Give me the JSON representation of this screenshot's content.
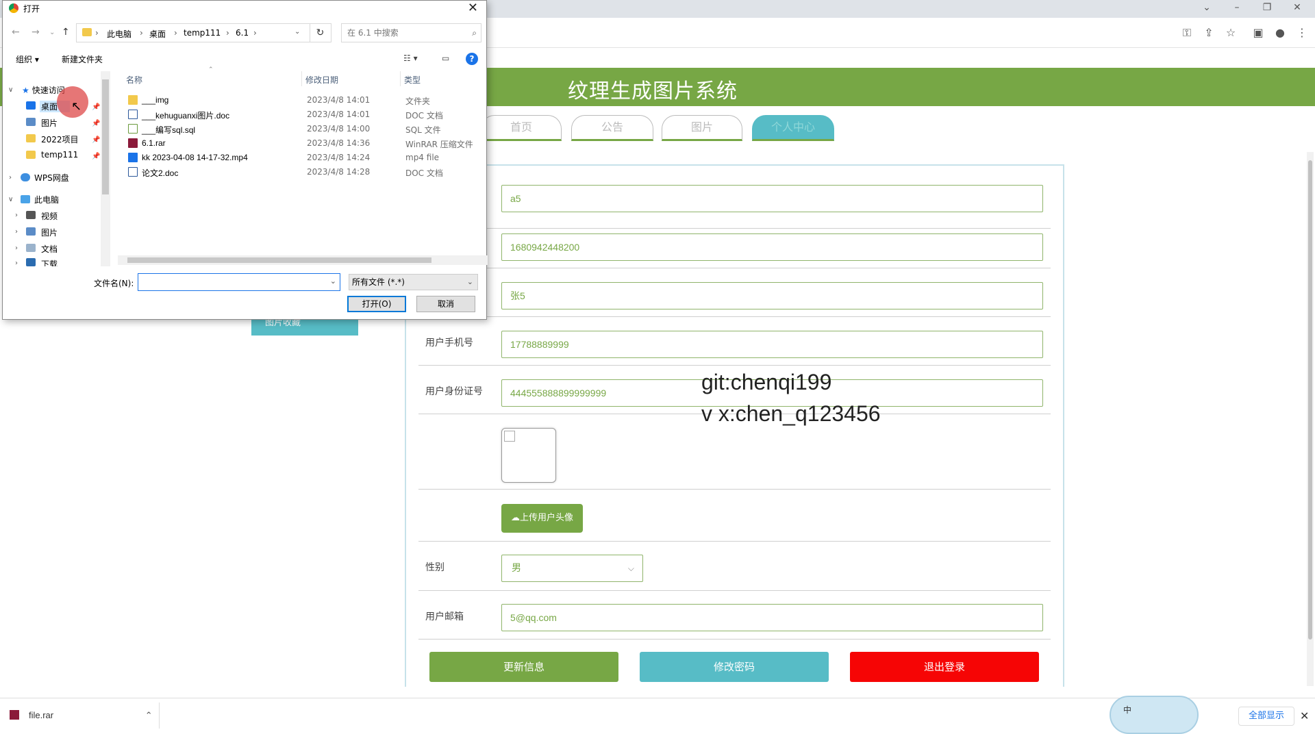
{
  "browser": {
    "window_controls": [
      "⌄",
      "–",
      "❐",
      "✕"
    ]
  },
  "page": {
    "site_title": "纹理生成图片系统",
    "nav_tabs": [
      {
        "label": "首页"
      },
      {
        "label": "公告"
      },
      {
        "label": "图片"
      },
      {
        "label": "个人中心"
      }
    ],
    "left_badge": "图片收藏",
    "form": {
      "field1_value": "a5",
      "field2_value": "1680942448200",
      "field3_value": "张5",
      "phone_label": "用户手机号",
      "phone_value": "17788889999",
      "id_label": "用户身份证号",
      "id_value": "444555888899999999",
      "upload_label": "上传用户头像",
      "gender_label": "性别",
      "gender_value": "男",
      "email_label": "用户邮箱",
      "email_value": "5@qq.com"
    },
    "buttons": {
      "update": "更新信息",
      "change_password": "修改密码",
      "logout": "退出登录"
    },
    "watermark": {
      "line1": "git:chenqi199",
      "line2": "v x:chen_q123456"
    },
    "colors": {
      "brand_green": "#77a745",
      "teal": "#57bcc6",
      "danger_red": "#f60505"
    }
  },
  "download_bar": {
    "file_name": "file.rar",
    "show_all": "全部显示",
    "ime_label": "中"
  },
  "dialog": {
    "title": "打开",
    "breadcrumb": [
      "此电脑",
      "桌面",
      "temp111",
      "6.1"
    ],
    "search_placeholder": "在 6.1 中搜索",
    "organize": "组织 ▾",
    "new_folder": "新建文件夹",
    "help": "?",
    "tree": [
      {
        "label": "快速访问"
      },
      {
        "label": "桌面"
      },
      {
        "label": "图片"
      },
      {
        "label": "2022项目"
      },
      {
        "label": "temp111"
      },
      {
        "label": "WPS网盘"
      },
      {
        "label": "此电脑"
      },
      {
        "label": "视频"
      },
      {
        "label": "图片"
      },
      {
        "label": "文档"
      },
      {
        "label": "下载"
      }
    ],
    "columns": {
      "name": "名称",
      "date": "修改日期",
      "type": "类型"
    },
    "files": [
      {
        "name": "___img",
        "date": "2023/4/8 14:01",
        "type": "文件夹",
        "icon": "folder-icon"
      },
      {
        "name": "___kehuguanxi图片.doc",
        "date": "2023/4/8 14:01",
        "type": "DOC 文档",
        "icon": "doc-icon"
      },
      {
        "name": "___编写sql.sql",
        "date": "2023/4/8 14:00",
        "type": "SQL 文件",
        "icon": "sql-icon"
      },
      {
        "name": "6.1.rar",
        "date": "2023/4/8 14:36",
        "type": "WinRAR 压缩文件",
        "icon": "rar-icon"
      },
      {
        "name": "kk 2023-04-08 14-17-32.mp4",
        "date": "2023/4/8 14:24",
        "type": "mp4 file",
        "icon": "video-icon"
      },
      {
        "name": "论文2.doc",
        "date": "2023/4/8 14:28",
        "type": "DOC 文档",
        "icon": "doc-icon"
      }
    ],
    "filename_label": "文件名(N):",
    "filename_value": "",
    "filetype_value": "所有文件 (*.*)",
    "open_button": "打开(O)",
    "cancel_button": "取消"
  }
}
